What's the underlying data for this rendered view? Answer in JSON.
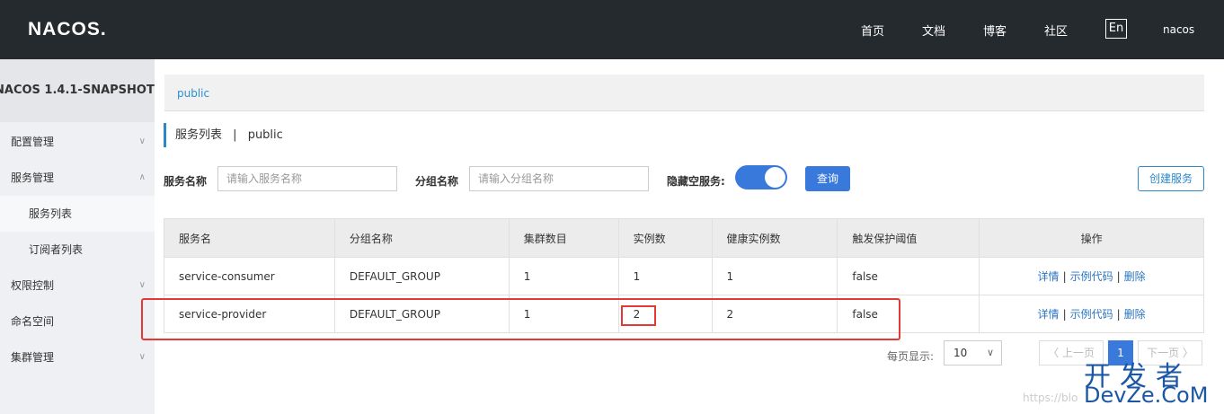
{
  "header": {
    "logo": "NACOS.",
    "nav": [
      "首页",
      "文档",
      "博客",
      "社区"
    ],
    "lang": "En",
    "user": "nacos"
  },
  "sidebar": {
    "title": "NACOS 1.4.1-SNAPSHOT",
    "items": [
      {
        "label": "配置管理",
        "chevron": "⌵"
      },
      {
        "label": "服务管理",
        "chevron": "^"
      },
      {
        "label": "服务列表"
      },
      {
        "label": "订阅者列表"
      },
      {
        "label": "权限控制",
        "chevron": "⌵"
      },
      {
        "label": "命名空间"
      },
      {
        "label": "集群管理",
        "chevron": "⌵"
      }
    ]
  },
  "main": {
    "breadcrumb": "public",
    "title": "服务列表",
    "title_sep": "|",
    "namespace": "public",
    "filters": {
      "service_label": "服务名称",
      "service_placeholder": "请输入服务名称",
      "group_label": "分组名称",
      "group_placeholder": "请输入分组名称",
      "hide_empty_label": "隐藏空服务:",
      "query_button": "查询",
      "create_button": "创建服务"
    },
    "table": {
      "headers": [
        "服务名",
        "分组名称",
        "集群数目",
        "实例数",
        "健康实例数",
        "触发保护阈值",
        "操作"
      ],
      "rows": [
        [
          "service-consumer",
          "DEFAULT_GROUP",
          "1",
          "1",
          "1",
          "false"
        ],
        [
          "service-provider",
          "DEFAULT_GROUP",
          "1",
          "2",
          "2",
          "false"
        ]
      ],
      "actions": [
        "详情",
        "示例代码",
        "删除"
      ],
      "action_sep": "|"
    },
    "pager": {
      "label": "每页显示:",
      "page_size": "10",
      "prev": "〈 上一页",
      "current": "1",
      "next": "下一页 〉"
    }
  },
  "watermark": {
    "url": "https://blo",
    "cn": "开发者",
    "en": "DevZe.CoM"
  },
  "colors": {
    "topbar": "#252a2f",
    "accent": "#3979db",
    "link": "#2b75c4",
    "highlight": "#e53935"
  }
}
